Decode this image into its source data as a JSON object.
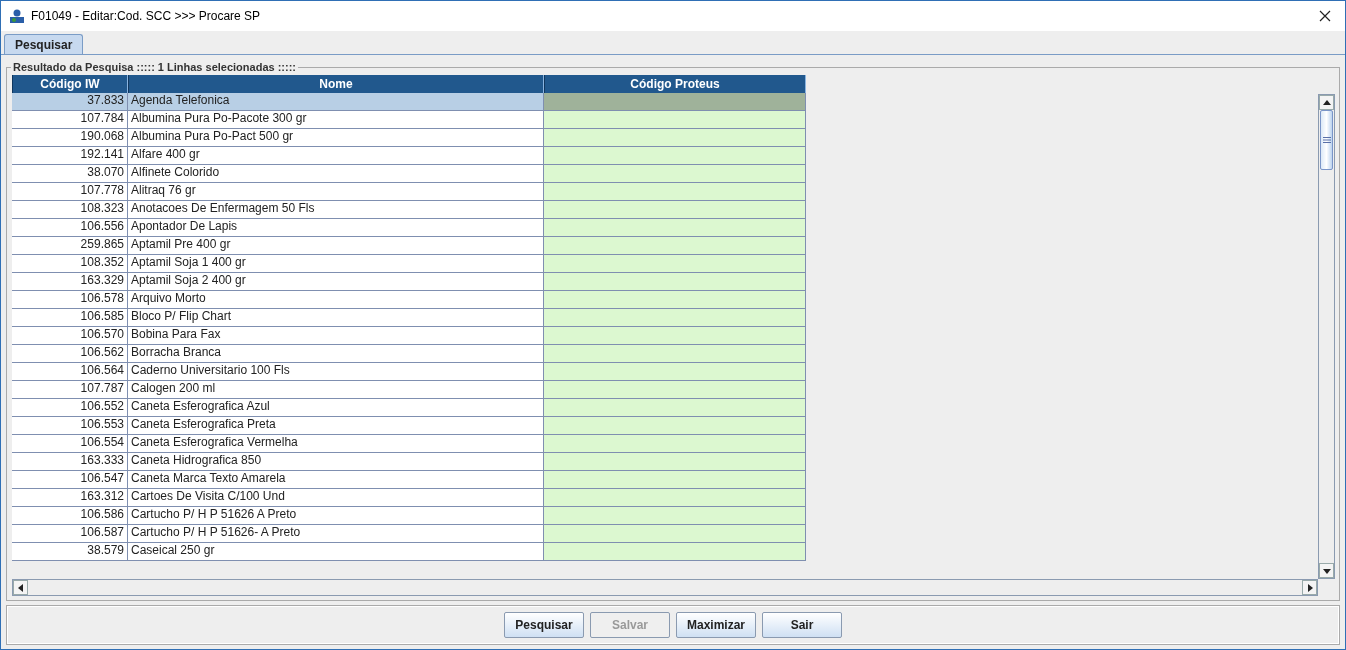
{
  "window": {
    "title": "F01049 - Editar:Cod. SCC >>> Procare SP"
  },
  "tabs": [
    {
      "label": "Pesquisar",
      "selected": true
    }
  ],
  "results": {
    "title": "Resultado da Pesquisa ::::: 1 Linhas selecionadas :::::",
    "columns": [
      "Código IW",
      "Nome",
      "Código Proteus"
    ],
    "rows": [
      {
        "code": "37.833",
        "name": "Agenda Telefonica",
        "selected": true
      },
      {
        "code": "107.784",
        "name": "Albumina Pura Po-Pacote 300 gr",
        "selected": false
      },
      {
        "code": "190.068",
        "name": "Albumina Pura Po-Pact 500 gr",
        "selected": false
      },
      {
        "code": "192.141",
        "name": "Alfare 400 gr",
        "selected": false
      },
      {
        "code": "38.070",
        "name": "Alfinete Colorido",
        "selected": false
      },
      {
        "code": "107.778",
        "name": "Alitraq 76 gr",
        "selected": false
      },
      {
        "code": "108.323",
        "name": "Anotacoes De Enfermagem 50 Fls",
        "selected": false
      },
      {
        "code": "106.556",
        "name": "Apontador De Lapis",
        "selected": false
      },
      {
        "code": "259.865",
        "name": "Aptamil Pre 400 gr",
        "selected": false
      },
      {
        "code": "108.352",
        "name": "Aptamil Soja 1 400 gr",
        "selected": false
      },
      {
        "code": "163.329",
        "name": "Aptamil Soja 2 400 gr",
        "selected": false
      },
      {
        "code": "106.578",
        "name": "Arquivo Morto",
        "selected": false
      },
      {
        "code": "106.585",
        "name": "Bloco P/ Flip Chart",
        "selected": false
      },
      {
        "code": "106.570",
        "name": "Bobina Para Fax",
        "selected": false
      },
      {
        "code": "106.562",
        "name": "Borracha Branca",
        "selected": false
      },
      {
        "code": "106.564",
        "name": "Caderno Universitario 100 Fls",
        "selected": false
      },
      {
        "code": "107.787",
        "name": "Calogen 200 ml",
        "selected": false
      },
      {
        "code": "106.552",
        "name": "Caneta Esferografica Azul",
        "selected": false
      },
      {
        "code": "106.553",
        "name": "Caneta Esferografica Preta",
        "selected": false
      },
      {
        "code": "106.554",
        "name": "Caneta Esferografica Vermelha",
        "selected": false
      },
      {
        "code": "163.333",
        "name": "Caneta Hidrografica 850",
        "selected": false
      },
      {
        "code": "106.547",
        "name": "Caneta Marca Texto Amarela",
        "selected": false
      },
      {
        "code": "163.312",
        "name": "Cartoes De Visita C/100 Und",
        "selected": false
      },
      {
        "code": "106.586",
        "name": "Cartucho P/ H P 51626 A Preto",
        "selected": false
      },
      {
        "code": "106.587",
        "name": "Cartucho P/ H P 51626- A Preto",
        "selected": false
      },
      {
        "code": "38.579",
        "name": "Caseical 250 gr",
        "selected": false
      }
    ]
  },
  "buttons": [
    {
      "label": "Pesquisar",
      "disabled": false
    },
    {
      "label": "Salvar",
      "disabled": true
    },
    {
      "label": "Maximizar",
      "disabled": false
    },
    {
      "label": "Sair",
      "disabled": false
    }
  ]
}
